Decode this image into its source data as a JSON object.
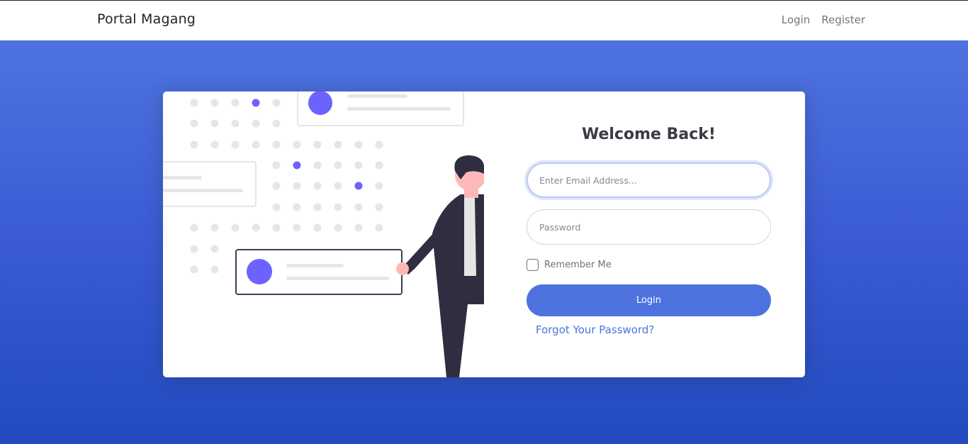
{
  "header": {
    "brand": "Portal Magang",
    "nav": {
      "login": "Login",
      "register": "Register"
    }
  },
  "login_card": {
    "title": "Welcome Back!",
    "email_placeholder": "Enter Email Address...",
    "password_placeholder": "Password",
    "remember_label": "Remember Me",
    "remember_checked": false,
    "submit_label": "Login",
    "forgot_label": "Forgot Your Password?"
  },
  "colors": {
    "primary": "#4e73df",
    "gradient_end": "#224abe",
    "illustration_accent": "#6c63ff",
    "person_dark": "#2f2e41",
    "skin": "#ffb8b8"
  },
  "icons": {
    "illustration": "person-presenting-dot-grid-illustration"
  }
}
